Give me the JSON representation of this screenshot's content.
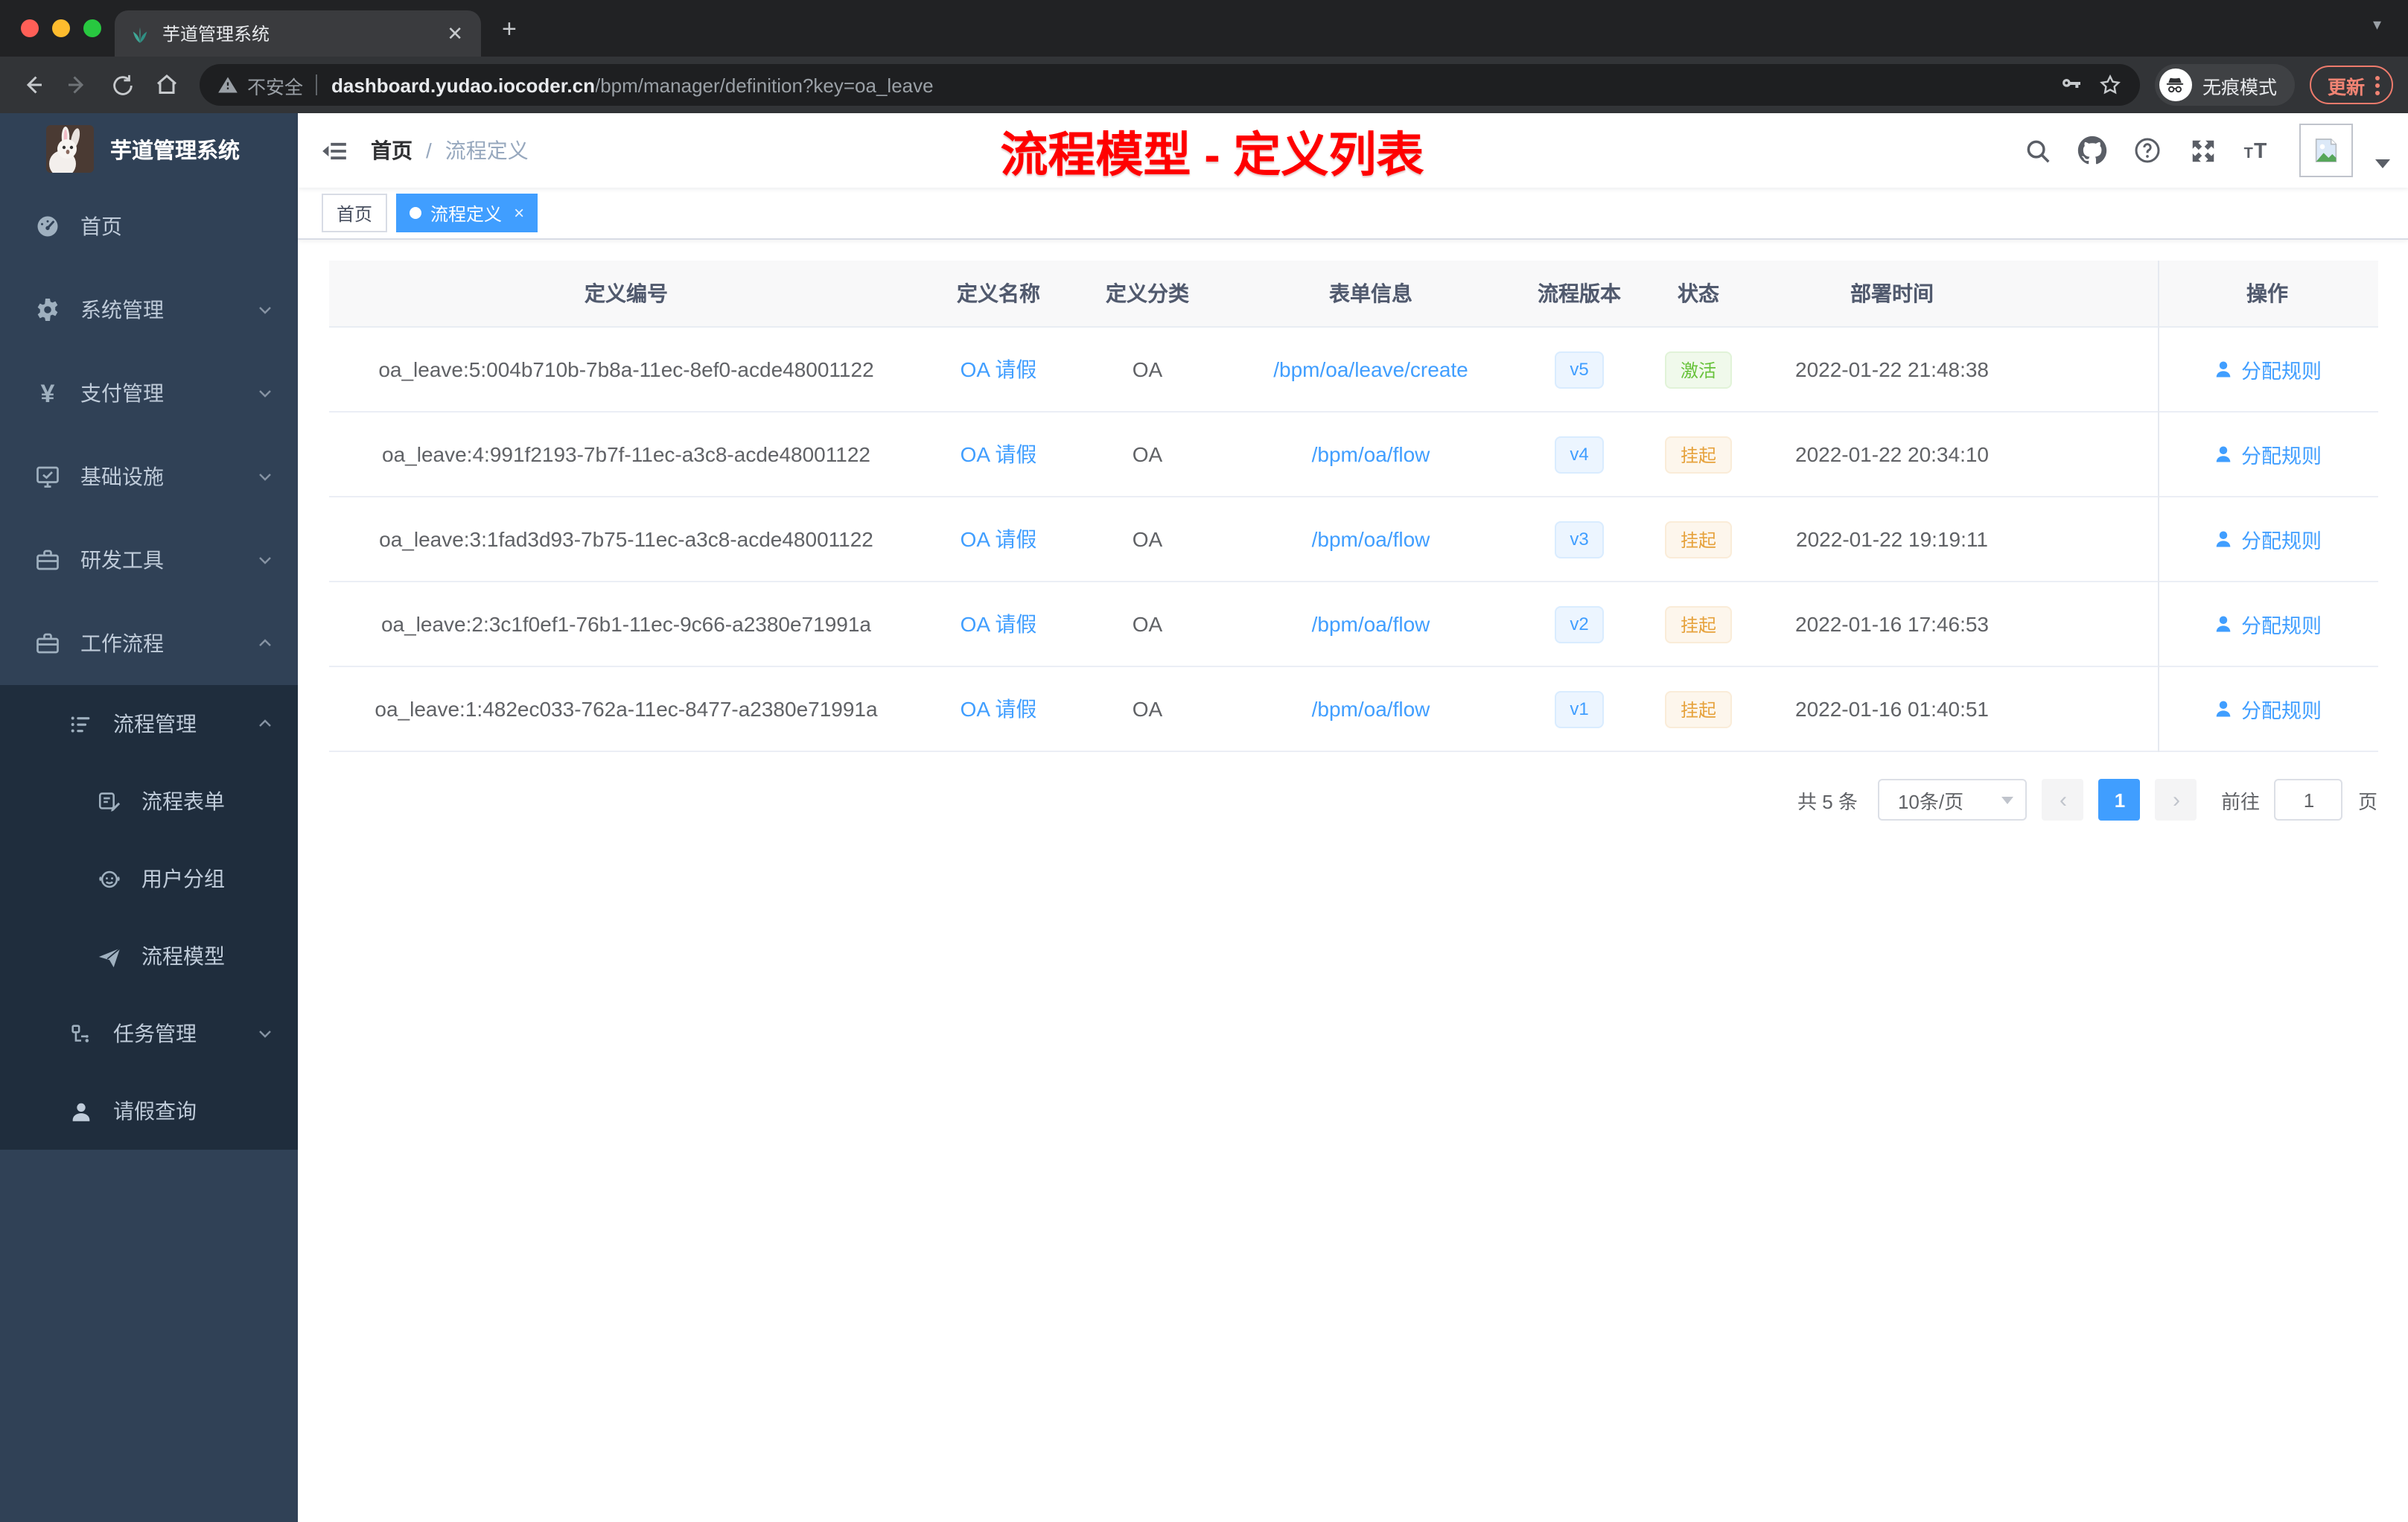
{
  "browser": {
    "tab_title": "芋道管理系统",
    "security_label": "不安全",
    "url_host": "dashboard.yudao.iocoder.cn",
    "url_path": "/bpm/manager/definition?key=oa_leave",
    "incognito_label": "无痕模式",
    "update_label": "更新"
  },
  "sidebar": {
    "app_title": "芋道管理系统",
    "items": [
      {
        "label": "首页"
      },
      {
        "label": "系统管理"
      },
      {
        "label": "支付管理"
      },
      {
        "label": "基础设施"
      },
      {
        "label": "研发工具"
      },
      {
        "label": "工作流程"
      },
      {
        "label": "流程管理"
      },
      {
        "label": "流程表单"
      },
      {
        "label": "用户分组"
      },
      {
        "label": "流程模型"
      },
      {
        "label": "任务管理"
      },
      {
        "label": "请假查询"
      }
    ]
  },
  "header": {
    "breadcrumb_home": "首页",
    "breadcrumb_sep": "/",
    "breadcrumb_current": "流程定义",
    "annotation": "流程模型 - 定义列表",
    "annotation_color": "#ff0000"
  },
  "tags": {
    "home": "首页",
    "active": "流程定义",
    "close": "×"
  },
  "table": {
    "columns": [
      "定义编号",
      "定义名称",
      "定义分类",
      "表单信息",
      "流程版本",
      "状态",
      "部署时间",
      "操作"
    ],
    "action_label": "分配规则",
    "rows": [
      {
        "id": "oa_leave:5:004b710b-7b8a-11ec-8ef0-acde48001122",
        "name": "OA 请假",
        "category": "OA",
        "form": "/bpm/oa/leave/create",
        "version": "v5",
        "status": "激活",
        "status_type": "success",
        "deployed": "2022-01-22 21:48:38"
      },
      {
        "id": "oa_leave:4:991f2193-7b7f-11ec-a3c8-acde48001122",
        "name": "OA 请假",
        "category": "OA",
        "form": "/bpm/oa/flow",
        "version": "v4",
        "status": "挂起",
        "status_type": "warning",
        "deployed": "2022-01-22 20:34:10"
      },
      {
        "id": "oa_leave:3:1fad3d93-7b75-11ec-a3c8-acde48001122",
        "name": "OA 请假",
        "category": "OA",
        "form": "/bpm/oa/flow",
        "version": "v3",
        "status": "挂起",
        "status_type": "warning",
        "deployed": "2022-01-22 19:19:11"
      },
      {
        "id": "oa_leave:2:3c1f0ef1-76b1-11ec-9c66-a2380e71991a",
        "name": "OA 请假",
        "category": "OA",
        "form": "/bpm/oa/flow",
        "version": "v2",
        "status": "挂起",
        "status_type": "warning",
        "deployed": "2022-01-16 17:46:53"
      },
      {
        "id": "oa_leave:1:482ec033-762a-11ec-8477-a2380e71991a",
        "name": "OA 请假",
        "category": "OA",
        "form": "/bpm/oa/flow",
        "version": "v1",
        "status": "挂起",
        "status_type": "warning",
        "deployed": "2022-01-16 01:40:51"
      }
    ]
  },
  "pagination": {
    "total": "共 5 条",
    "page_size": "10条/页",
    "prev": "‹",
    "page": "1",
    "next": "›",
    "goto": "前往",
    "goto_value": "1",
    "unit": "页"
  },
  "colors": {
    "accent_blue": "#409eff",
    "success_green": "#67c23a",
    "warning_orange": "#e6a23c",
    "sidebar_bg": "#304156",
    "submenu_bg": "#1f2d3d"
  }
}
